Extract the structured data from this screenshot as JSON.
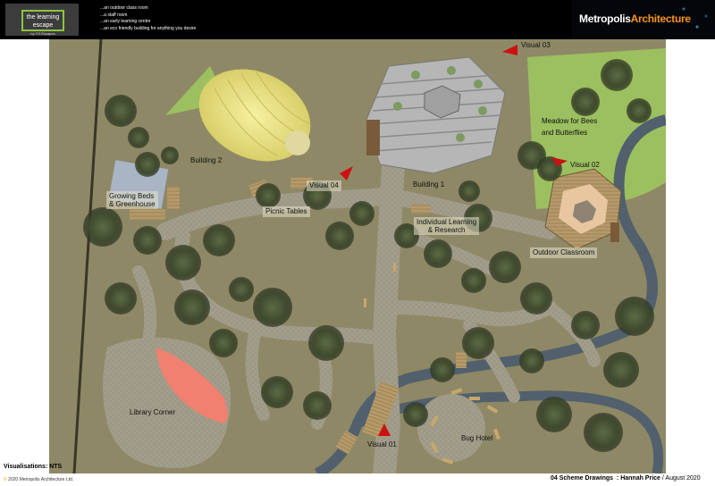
{
  "header": {
    "brand_left": "the learning escape",
    "brand_left_tagline": "by TG Escapes",
    "taglines": [
      "...an outdoor class room",
      "...a staff room",
      "...an early learning centre",
      "...an eco friendly building for anything you desire"
    ],
    "brand_right_main": "Metropolis",
    "brand_right_accent": "Architecture"
  },
  "plan": {
    "labels": {
      "building_2": "Building 2",
      "building_1": "Building 1",
      "growing_beds_line1": "Growing Beds",
      "growing_beds_line2": "& Greenhouse",
      "picnic_tables": "Picnic Tables",
      "individual_learning_line1": "Individual Learning",
      "individual_learning_line2": "& Research",
      "outdoor_classroom": "Outdoor Classroom",
      "meadow_line1": "Meadow for Bees",
      "meadow_line2": "and Butterflies",
      "library_corner": "Library Corner",
      "bug_hotel": "Bug Hotel",
      "visual_01": "Visual 01",
      "visual_02": "Visual 02",
      "visual_03": "Visual 03",
      "visual_04": "Visual 04"
    },
    "colors": {
      "ground": "#8e8866",
      "meadow": "#9cbf60",
      "water": "#5a7080",
      "path": "#a09a8a",
      "library": "#f08070",
      "marker": "#cc1111"
    }
  },
  "footer": {
    "scale_note": "Visualisations: NTS",
    "copyright": "2020 Metropolis Architecture Ltd.",
    "drawing_title": "04 Scheme Drawings",
    "author": ": Hannah Price",
    "date": "/ August 2020"
  }
}
